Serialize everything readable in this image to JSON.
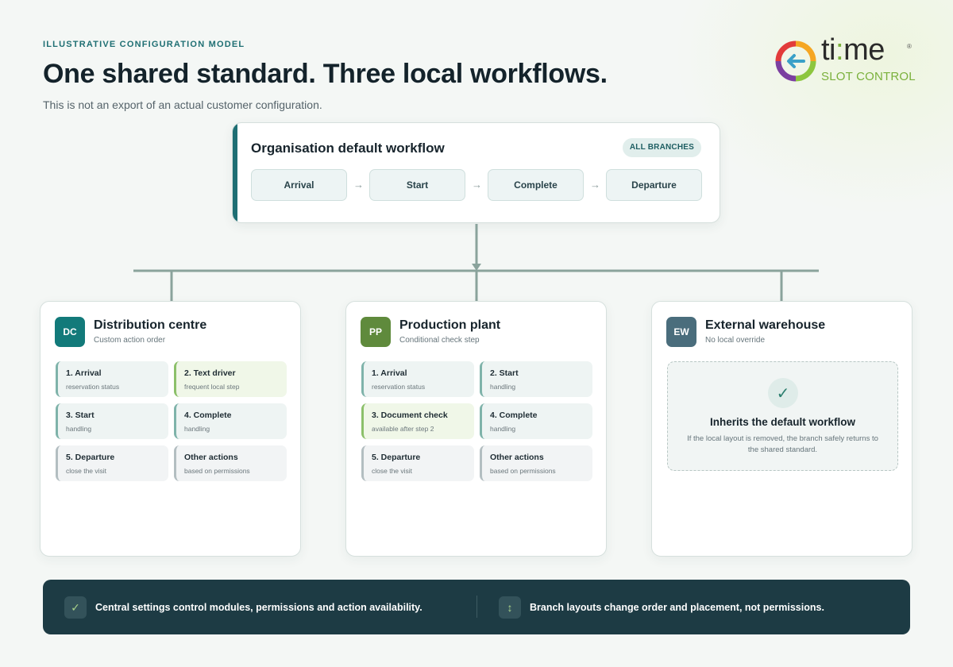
{
  "header": {
    "eyebrow": "ILLUSTRATIVE CONFIGURATION MODEL",
    "title": "One shared standard. Three local workflows.",
    "subtitle": "This is not an export of an actual customer configuration."
  },
  "logo": {
    "word_prefix": "ti",
    "word_colon": ":",
    "word_suffix": "me",
    "registered": "®",
    "sub": "SLOT CONTROL",
    "icon": "ring-arrow-logo-icon"
  },
  "default_workflow": {
    "title": "Organisation default workflow",
    "badge": "ALL BRANCHES",
    "steps": [
      "Arrival",
      "Start",
      "Complete",
      "Departure"
    ],
    "arrow_glyph": "→"
  },
  "branches": [
    {
      "code": "DC",
      "code_color": "#127a7a",
      "name": "Distribution centre",
      "desc": "Custom action order",
      "tiles": [
        {
          "title": "1. Arrival",
          "sub": "reservation status",
          "kind": "base"
        },
        {
          "title": "2. Text driver",
          "sub": "frequent local step",
          "kind": "local"
        },
        {
          "title": "3. Start",
          "sub": "handling",
          "kind": "base"
        },
        {
          "title": "4. Complete",
          "sub": "handling",
          "kind": "base"
        },
        {
          "title": "5. Departure",
          "sub": "close the visit",
          "kind": "other"
        },
        {
          "title": "Other actions",
          "sub": "based on permissions",
          "kind": "other"
        }
      ]
    },
    {
      "code": "PP",
      "code_color": "#5f8a3c",
      "name": "Production plant",
      "desc": "Conditional check step",
      "tiles": [
        {
          "title": "1. Arrival",
          "sub": "reservation status",
          "kind": "base"
        },
        {
          "title": "2. Start",
          "sub": "handling",
          "kind": "base"
        },
        {
          "title": "3. Document check",
          "sub": "available after step 2",
          "kind": "local"
        },
        {
          "title": "4. Complete",
          "sub": "handling",
          "kind": "base"
        },
        {
          "title": "5. Departure",
          "sub": "close the visit",
          "kind": "other"
        },
        {
          "title": "Other actions",
          "sub": "based on permissions",
          "kind": "other"
        }
      ]
    },
    {
      "code": "EW",
      "code_color": "#4a6d7c",
      "name": "External warehouse",
      "desc": "No local override",
      "inherit": {
        "check": "✓",
        "title": "Inherits the default workflow",
        "text": "If the local layout is removed, the branch safely returns to the shared standard."
      }
    }
  ],
  "footer": {
    "items": [
      {
        "icon": "check-icon",
        "glyph": "✓",
        "text": "Central settings control modules, permissions and action availability."
      },
      {
        "icon": "swap-vertical-icon",
        "glyph": "↕",
        "text": "Branch layouts change order and placement, not permissions."
      }
    ]
  },
  "colors": {
    "accent_teal": "#1e6e73",
    "connector": "#8aa39c",
    "local_green": "#8cc06a",
    "footer_bg": "#1d3b44"
  }
}
